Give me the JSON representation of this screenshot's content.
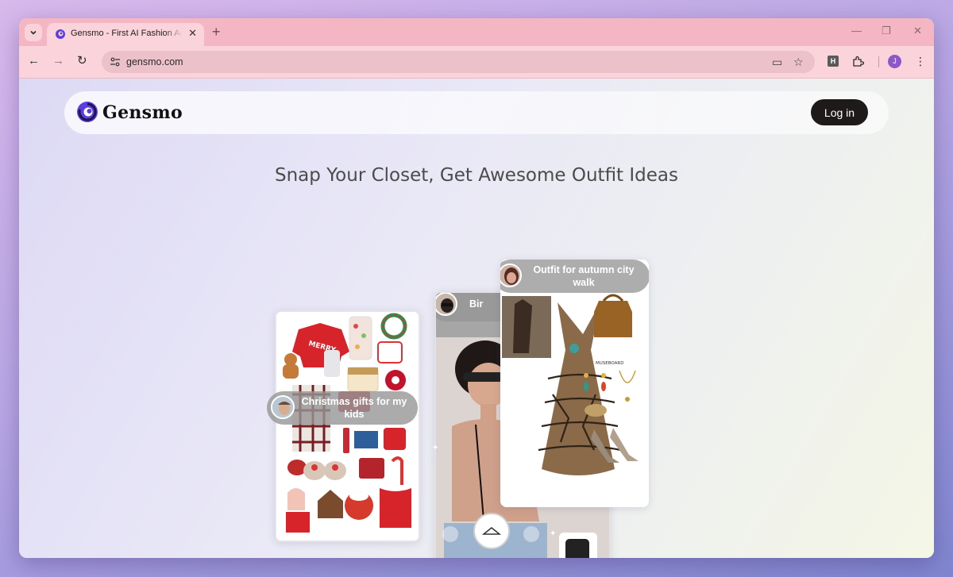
{
  "browser": {
    "tab": {
      "title": "Gensmo - First AI Fashion Agent",
      "close_glyph": "✕",
      "favicon": "gensmo-favicon-icon"
    },
    "new_tab_glyph": "+",
    "window_controls": {
      "minimize": "—",
      "restore": "❐",
      "close": "✕"
    },
    "nav": {
      "back": "←",
      "forward": "→",
      "reload": "↻"
    },
    "omnibox": {
      "url": "gensmo.com"
    },
    "toolbar_icons": {
      "cast": "▭",
      "bookmark": "☆",
      "extension_h": "H",
      "extensions": "⬚",
      "menu": "⋮"
    },
    "profile_initial": "J"
  },
  "site": {
    "logo_text": "Gensmo",
    "login_label": "Log in",
    "headline": "Snap Your Closet, Get Awesome Outfit Ideas",
    "brand_colors": {
      "logo_purple": "#5a3fe0",
      "logo_dark": "#24124f",
      "login_bg": "#1f1a1a"
    }
  },
  "cards": {
    "left": {
      "prompt": "Christmas gifts for my kids"
    },
    "middle": {
      "prompt": "Bir"
    },
    "right": {
      "prompt": "Outfit for autumn city walk",
      "brand_label": "MUSEBOARD"
    }
  }
}
